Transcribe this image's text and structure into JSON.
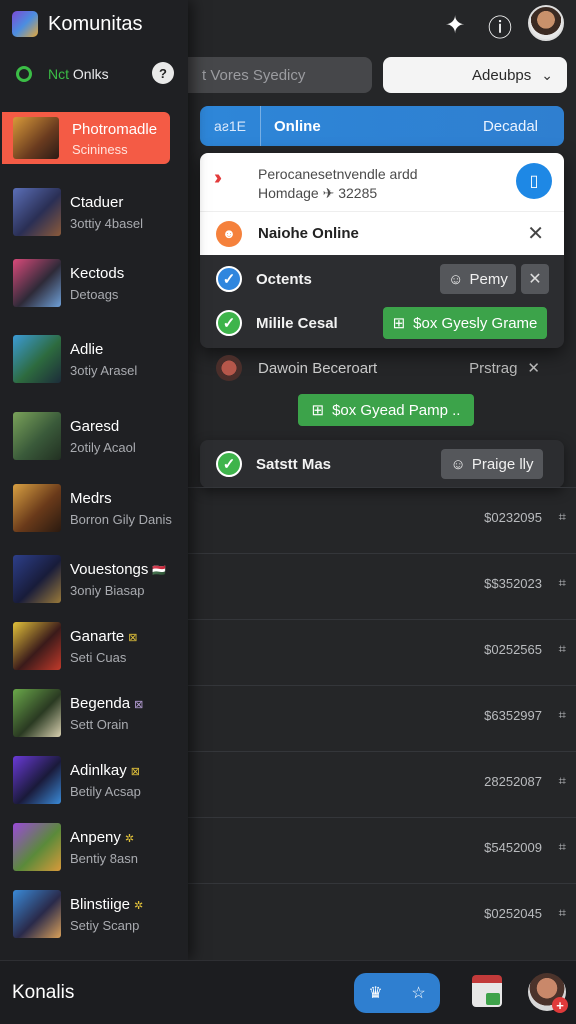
{
  "app": {
    "title": "Komunitas"
  },
  "status": {
    "prefix": "Nct",
    "label": "Onlks",
    "help": "?"
  },
  "header": {
    "search_placeholder": "t Vores Syedicy",
    "dropdown_label": "Adeubps"
  },
  "blue_bar": {
    "sub": "aƨ1E",
    "main": "Online",
    "right": "Decadal"
  },
  "popup": {
    "notification": {
      "line1": "Perocanesetnvendle ardd",
      "line2": "Homdage ✈ 32285"
    },
    "top_row": {
      "label": "Naiohe Online"
    },
    "rows": [
      {
        "label": "Octents",
        "button": "Pemy"
      },
      {
        "label": "Milile Cesal",
        "button": "$ox Gyesly Grame"
      }
    ]
  },
  "loose_row": {
    "label": "Dawoin Beceroart",
    "right": "Prstrag"
  },
  "loose_button": "$ox Gyead Pamp ..",
  "card2": {
    "label": "Satstt Mas",
    "button": "Praige lly"
  },
  "amounts": [
    "$0232095",
    "$$352023",
    "$0252565",
    "$6352997",
    "28252087",
    "$5452009",
    "$0252045"
  ],
  "sidebar": {
    "items": [
      {
        "title": "Photromadle",
        "subtitle": "Scininess",
        "tag": ""
      },
      {
        "title": "Ctaduer",
        "subtitle": "3ottiy 4basel",
        "tag": ""
      },
      {
        "title": "Kectods",
        "subtitle": "Detoags",
        "tag": ""
      },
      {
        "title": "Adlie",
        "subtitle": "3otiy Arasel",
        "tag": ""
      },
      {
        "title": "Garesd",
        "subtitle": "2otily Acaol",
        "tag": ""
      },
      {
        "title": "Medrs",
        "subtitle": "Borron Gily Danis",
        "tag": ""
      },
      {
        "title": "Vouestongs",
        "subtitle": "3oniy Biasap",
        "tag": "🇭🇺"
      },
      {
        "title": "Ganarte",
        "subtitle": "Seti Cuas",
        "tag": "⊠"
      },
      {
        "title": "Begenda",
        "subtitle": "Sett Orain",
        "tag": "⊠"
      },
      {
        "title": "Adinlkay",
        "subtitle": "Betily Acsap",
        "tag": "⊠"
      },
      {
        "title": "Anpeny",
        "subtitle": "Bentiy 8asn",
        "tag": "✲"
      },
      {
        "title": "Blinstiige",
        "subtitle": "Setiy Scanp",
        "tag": "✲"
      }
    ]
  },
  "bottom": {
    "title": "Konalis"
  },
  "colors": {
    "accent_blue": "#2f7fd0",
    "active_item": "#f45b45",
    "online_green": "#3bbd46",
    "button_green": "#3ca34a"
  }
}
